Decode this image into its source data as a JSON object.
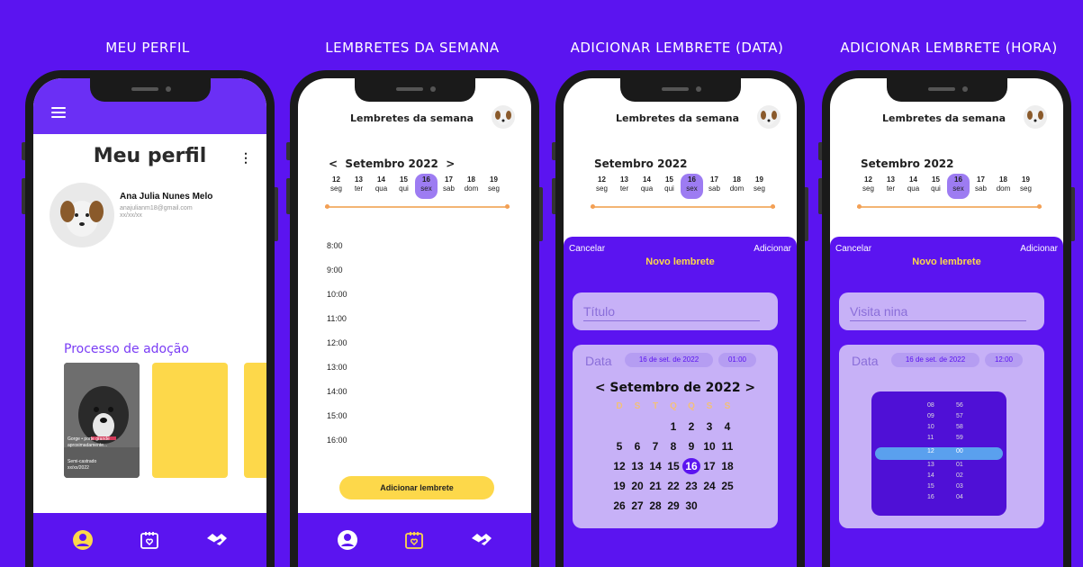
{
  "frames": {
    "f1": "MEU PERFIL",
    "f2": "LEMBRETES DA SEMANA",
    "f3": "ADICIONAR LEMBRETE (DATA)",
    "f4": "ADICIONAR LEMBRETE (HORA)"
  },
  "profile": {
    "title": "Meu perfil",
    "menu": "⋮",
    "name": "Ana Julia Nunes Melo",
    "email": "anajulianm18@gmail.com",
    "dob": "xx/xx/xx",
    "process_title": "Processo de adoção",
    "dog_card": {
      "line1": "Gorge • porte grande",
      "line2": "aproximadamente...",
      "line3": "Semi-castrado",
      "line4": "xx/xx/2022"
    }
  },
  "reminders": {
    "title": "Lembretes da semana",
    "month": "Setembro 2022",
    "prev": "<",
    "next": ">",
    "days": [
      {
        "n": "12",
        "w": "seg"
      },
      {
        "n": "13",
        "w": "ter"
      },
      {
        "n": "14",
        "w": "qua"
      },
      {
        "n": "15",
        "w": "qui"
      },
      {
        "n": "16",
        "w": "sex"
      },
      {
        "n": "17",
        "w": "sab"
      },
      {
        "n": "18",
        "w": "dom"
      },
      {
        "n": "19",
        "w": "seg"
      }
    ],
    "selected_day_index": 4,
    "hours": [
      "8:00",
      "9:00",
      "10:00",
      "11:00",
      "12:00",
      "13:00",
      "14:00",
      "15:00",
      "16:00"
    ],
    "add_button": "Adicionar lembrete"
  },
  "modal_date": {
    "cancel": "Cancelar",
    "add": "Adicionar",
    "title": "Novo lembrete",
    "field_placeholder": "Título",
    "data_label": "Data",
    "date_pill": "16 de set. de 2022",
    "time_pill": "01:00",
    "cal_month": "< Setembro de 2022 >",
    "weekdays": [
      "D",
      "S",
      "T",
      "Q",
      "Q",
      "S",
      "S"
    ],
    "cal_rows": [
      [
        "",
        "",
        "",
        "",
        "1",
        "2",
        "3",
        "4"
      ],
      [
        "5",
        "6",
        "7",
        "8",
        "9",
        "10",
        "11"
      ],
      [
        "12",
        "13",
        "14",
        "15",
        "16",
        "17",
        "18"
      ],
      [
        "19",
        "20",
        "21",
        "22",
        "23",
        "24",
        "25"
      ],
      [
        "26",
        "27",
        "28",
        "29",
        "30",
        "",
        ""
      ]
    ],
    "selected_date": "16"
  },
  "modal_time": {
    "cancel": "Cancelar",
    "add": "Adicionar",
    "title": "Novo lembrete",
    "field_value": "Visita nina",
    "data_label": "Data",
    "date_pill": "16 de set. de 2022",
    "time_pill": "12:00",
    "hours": [
      "08",
      "09",
      "10",
      "11",
      "12",
      "13",
      "14",
      "15",
      "16"
    ],
    "minutes": [
      "56",
      "57",
      "58",
      "59",
      "00",
      "01",
      "02",
      "03",
      "04"
    ],
    "selected_hour": "12",
    "selected_minute": "00"
  },
  "colors": {
    "background": "#5b14f0",
    "accent_yellow": "#fdd84a",
    "lavender": "#c7b1f7",
    "selected_day": "#9d7cf2"
  }
}
